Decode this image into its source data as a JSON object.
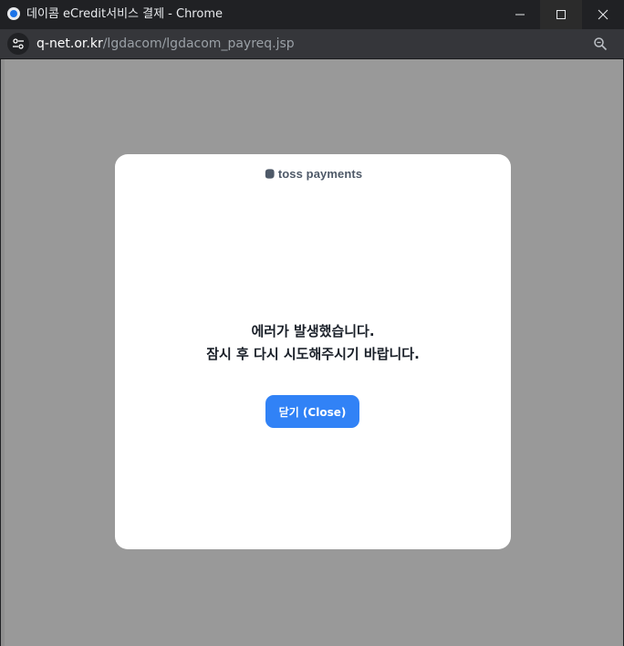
{
  "window": {
    "title": "데이콤 eCredit서비스 결제 - Chrome",
    "app_icon": "chrome-app-icon",
    "controls": [
      "minimize-icon",
      "maximize-icon",
      "close-icon"
    ]
  },
  "address_bar": {
    "host": "q-net.or.kr",
    "path": "/lgdacom/lgdacom_payreq.jsp",
    "site_info_icon": "tune-icon",
    "zoom_icon": "zoom-icon"
  },
  "modal": {
    "brand": "toss payments",
    "message_line1": "에러가 발생했습니다.",
    "message_line2": "잠시 후 다시 시도해주시기 바랍니다.",
    "close_label": "닫기 (Close)"
  },
  "colors": {
    "titlebar": "#202124",
    "addressbar": "#35363a",
    "overlay": "#999999",
    "modal_bg": "#ffffff",
    "accent": "#3182f6",
    "message_text": "#191f28",
    "brand_text": "#4e5968"
  }
}
